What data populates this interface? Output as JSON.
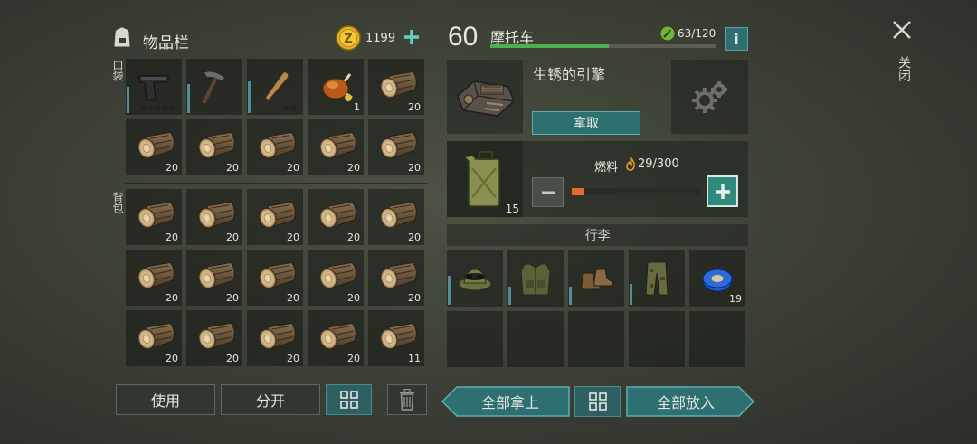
{
  "inventory": {
    "title": "物品栏",
    "gold": "1199",
    "pocket_label": "口袋",
    "backpack_label": "背包",
    "pocket_slots": [
      {
        "item": "pistol-icon",
        "qty": "",
        "bar": 0.5,
        "dots": "●●●●●"
      },
      {
        "item": "pickaxe-icon",
        "qty": "",
        "bar": 0.55,
        "dots": ""
      },
      {
        "item": "baseball-bat-icon",
        "qty": "",
        "bar": 0.6,
        "dots": "●●"
      },
      {
        "item": "roast-chicken-icon",
        "qty": "1",
        "bar": 0,
        "dots": ""
      },
      {
        "item": "log-icon",
        "qty": "20",
        "bar": 0,
        "dots": ""
      },
      {
        "item": "log-icon",
        "qty": "20",
        "bar": 0,
        "dots": ""
      },
      {
        "item": "log-icon",
        "qty": "20",
        "bar": 0,
        "dots": ""
      },
      {
        "item": "log-icon",
        "qty": "20",
        "bar": 0,
        "dots": ""
      },
      {
        "item": "log-icon",
        "qty": "20",
        "bar": 0,
        "dots": ""
      },
      {
        "item": "log-icon",
        "qty": "20",
        "bar": 0,
        "dots": ""
      }
    ],
    "backpack_slots": [
      {
        "item": "log-icon",
        "qty": "20"
      },
      {
        "item": "log-icon",
        "qty": "20"
      },
      {
        "item": "log-icon",
        "qty": "20"
      },
      {
        "item": "log-icon",
        "qty": "20"
      },
      {
        "item": "log-icon",
        "qty": "20"
      },
      {
        "item": "log-icon",
        "qty": "20"
      },
      {
        "item": "log-icon",
        "qty": "20"
      },
      {
        "item": "log-icon",
        "qty": "20"
      },
      {
        "item": "log-icon",
        "qty": "20"
      },
      {
        "item": "log-icon",
        "qty": "20"
      },
      {
        "item": "log-icon",
        "qty": "20"
      },
      {
        "item": "log-icon",
        "qty": "20"
      },
      {
        "item": "log-icon",
        "qty": "20"
      },
      {
        "item": "log-icon",
        "qty": "20"
      },
      {
        "item": "log-icon",
        "qty": "11"
      }
    ],
    "use_label": "使用",
    "split_label": "分开"
  },
  "vehicle": {
    "level": "60",
    "name": "摩托车",
    "durability": "63/120",
    "durability_fraction": 0.525,
    "part_name": "生锈的引擎",
    "take_label": "拿取",
    "fuel_label": "燃料",
    "fuel_value": "29/300",
    "fuel_fraction": 0.097,
    "canister_qty": "15",
    "trunk_label": "行李",
    "trunk_slots": [
      {
        "item": "camo-hat-icon",
        "qty": "",
        "bar": 0.55
      },
      {
        "item": "military-vest-icon",
        "qty": "",
        "bar": 0.35
      },
      {
        "item": "boots-icon",
        "qty": "",
        "bar": 0.35
      },
      {
        "item": "camo-pants-icon",
        "qty": "",
        "bar": 0.4
      },
      {
        "item": "tape-icon",
        "qty": "19",
        "bar": 0
      },
      {
        "item": "",
        "qty": "",
        "bar": 0
      },
      {
        "item": "",
        "qty": "",
        "bar": 0
      },
      {
        "item": "",
        "qty": "",
        "bar": 0
      },
      {
        "item": "",
        "qty": "",
        "bar": 0
      },
      {
        "item": "",
        "qty": "",
        "bar": 0
      }
    ],
    "take_all_label": "全部拿上",
    "put_all_label": "全部放入"
  },
  "close_label": "关闭",
  "colors": {
    "accent": "#5fd1c0",
    "teal_button": "#2e6f72",
    "green_bar": "#4caf50",
    "fuel_orange": "#e8692c"
  }
}
